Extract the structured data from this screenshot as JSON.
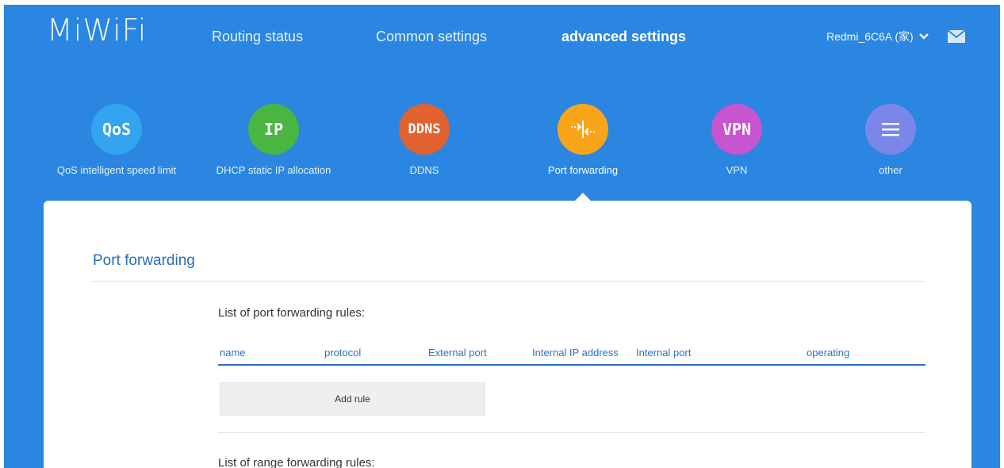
{
  "brand": {
    "logo": "MiWiFi"
  },
  "topnav": [
    {
      "label": "Routing status"
    },
    {
      "label": "Common settings"
    },
    {
      "label": "advanced settings"
    }
  ],
  "user": {
    "device": "Redmi_6C6A (家)"
  },
  "features": [
    {
      "icon_text": "QoS",
      "label": "QoS intelligent speed limit",
      "color": "#33a4ef"
    },
    {
      "icon_text": "IP",
      "label": "DHCP static IP allocation",
      "color": "#4ab641"
    },
    {
      "icon_text": "DDNS",
      "label": "DDNS",
      "color": "#e0622e"
    },
    {
      "icon_text": "",
      "label": "Port forwarding",
      "color": "#f8a51a"
    },
    {
      "icon_text": "VPN",
      "label": "VPN",
      "color": "#c655cf"
    },
    {
      "icon_text": "",
      "label": "other",
      "color": "#7a86e8"
    }
  ],
  "panel": {
    "title": "Port forwarding",
    "list_title": "List of port forwarding rules:",
    "columns": [
      "name",
      "protocol",
      "External port",
      "Internal IP address",
      "Internal port",
      "operating"
    ],
    "add_button": "Add rule",
    "range_title": "List of range forwarding rules:"
  }
}
